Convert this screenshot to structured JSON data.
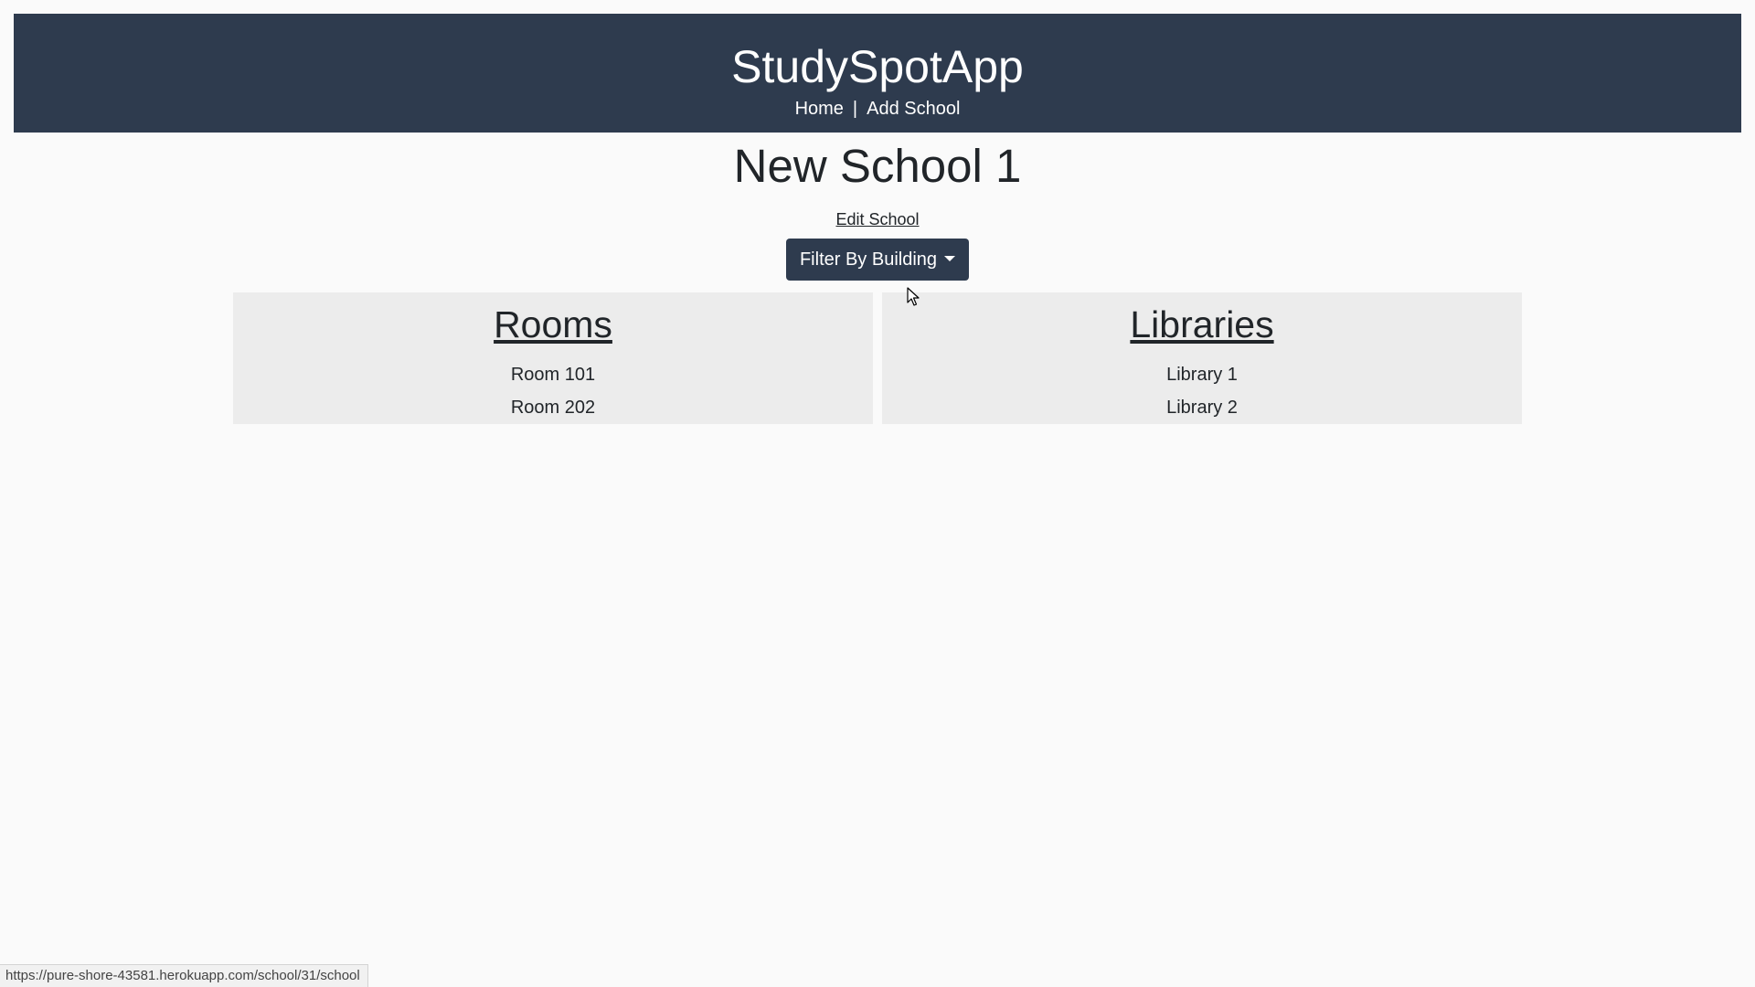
{
  "header": {
    "brand": "StudySpotApp",
    "nav": {
      "home": "Home",
      "separator": "|",
      "add_school": "Add School"
    }
  },
  "main": {
    "school_name": "New School 1",
    "edit_link": "Edit School",
    "filter_button": "Filter By Building"
  },
  "rooms": {
    "heading": "Rooms",
    "items": [
      "Room 101",
      "Room 202"
    ]
  },
  "libraries": {
    "heading": "Libraries",
    "items": [
      "Library 1",
      "Library 2"
    ]
  },
  "status_bar": {
    "url": "https://pure-shore-43581.herokuapp.com/school/31/school"
  },
  "colors": {
    "header_bg": "#2e3b4e",
    "page_bg": "#fafafa",
    "panel_bg": "#ececec",
    "text": "#212529"
  },
  "icons": {
    "dropdown": "caret-down-icon",
    "pointer": "mouse-cursor-icon"
  }
}
